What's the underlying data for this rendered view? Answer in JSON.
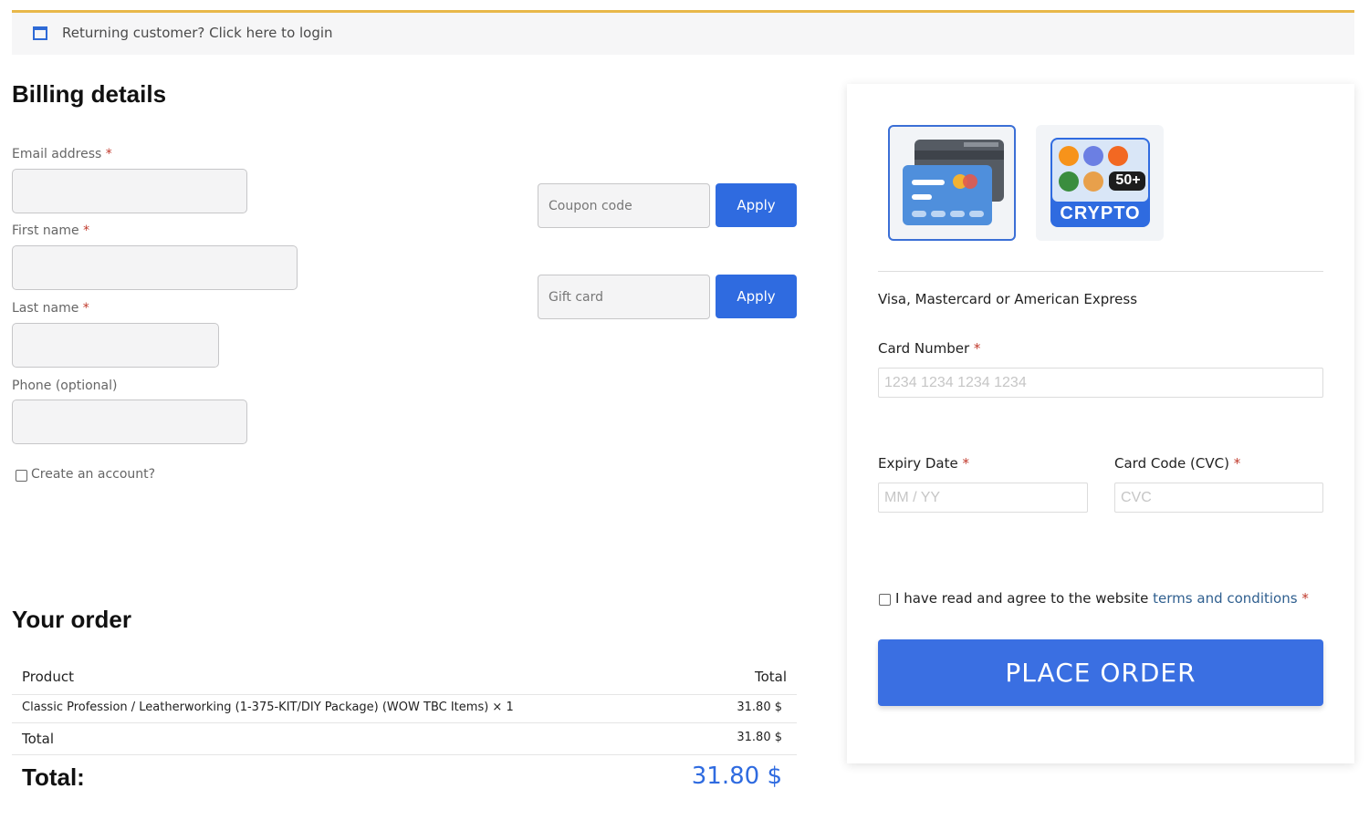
{
  "notice": {
    "text": "Returning customer? Click here to login",
    "icon": "window-icon"
  },
  "billing": {
    "title": "Billing details",
    "fields": [
      {
        "label": "Email address",
        "required": "*",
        "value": ""
      },
      {
        "label": "First name",
        "required": "*",
        "value": ""
      },
      {
        "label": "Last name",
        "required": "*",
        "value": ""
      },
      {
        "label": "Phone (optional)",
        "value": ""
      }
    ],
    "create_account": "Create an account?"
  },
  "coupon": {
    "placeholder": "Coupon code",
    "button": "Apply"
  },
  "giftcard": {
    "placeholder": "Gift card",
    "button": "Apply"
  },
  "order": {
    "title": "Your order",
    "col_product": "Product",
    "col_total": "Total",
    "item_name": "Classic Profession / Leatherworking (1-375-KIT/DIY Package) (WOW TBC Items) × 1",
    "item_total": "31.80 $",
    "subtotal_label": "Total",
    "subtotal_value": "31.80 $",
    "grand_label": "Total:",
    "grand_value": "31.80 $"
  },
  "payment": {
    "methods": [
      {
        "name": "card-method",
        "icon": "credit-card-icon",
        "selected": true
      },
      {
        "name": "crypto-method",
        "badge": "50+",
        "label": "CRYPTO",
        "selected": false
      }
    ],
    "description": "Visa, Mastercard or American Express",
    "card_number_label": "Card Number",
    "card_number_placeholder": "1234 1234 1234 1234",
    "expiry_label": "Expiry Date",
    "expiry_placeholder": "MM / YY",
    "cvc_label": "Card Code (CVC)",
    "cvc_placeholder": "CVC",
    "required": "*",
    "terms_prefix": "I have read and agree to the website ",
    "terms_link": "terms and conditions",
    "place_order": "PLACE ORDER"
  },
  "colors": {
    "accent": "#2f6be0",
    "notice_border": "#e8b84a",
    "required": "#c0392b"
  }
}
